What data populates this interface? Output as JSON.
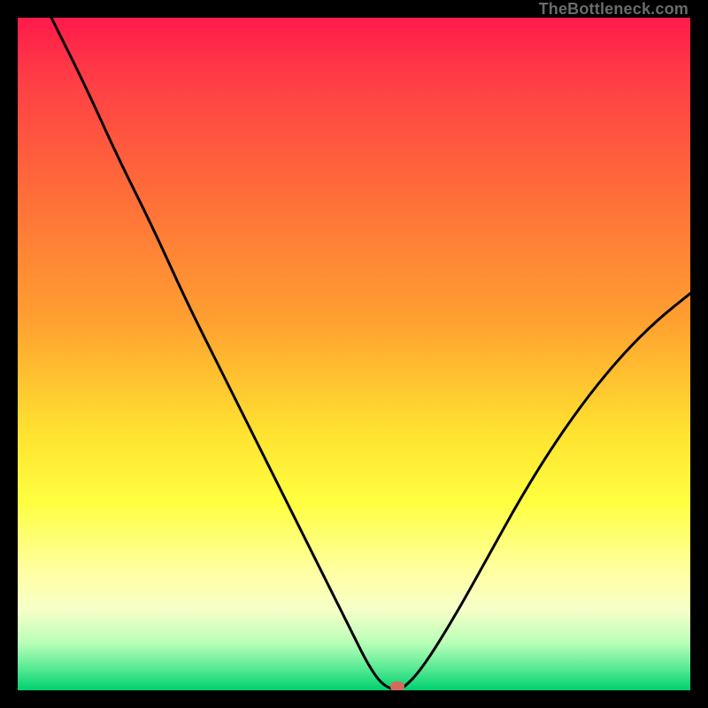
{
  "watermark": "TheBottleneck.com",
  "colors": {
    "curve": "#000000",
    "marker": "#d66a5a",
    "gradient_top": "#ff1a4a",
    "gradient_bottom": "#00d070"
  },
  "chart_data": {
    "type": "line",
    "title": "",
    "xlabel": "",
    "ylabel": "",
    "xlim": [
      0,
      100
    ],
    "ylim": [
      0,
      100
    ],
    "grid": false,
    "x": [
      5,
      10,
      15,
      20,
      25,
      30,
      35,
      40,
      45,
      50,
      52,
      54,
      56,
      57,
      60,
      65,
      70,
      75,
      80,
      85,
      90,
      95,
      100
    ],
    "y": [
      100,
      90,
      79,
      69,
      58,
      48,
      38,
      28,
      18,
      8,
      4,
      1,
      0,
      0,
      3,
      11,
      20,
      29,
      37,
      44,
      50,
      55,
      59
    ],
    "min_point": {
      "x": 56.5,
      "y": 0
    },
    "note": "x is horizontal position as percent (left=0, right=100); y is bottleneck percent (0 at bottom/green, 100 at top/red). Curve falls from top-left to a minimum near x≈56 then rises toward the right."
  }
}
